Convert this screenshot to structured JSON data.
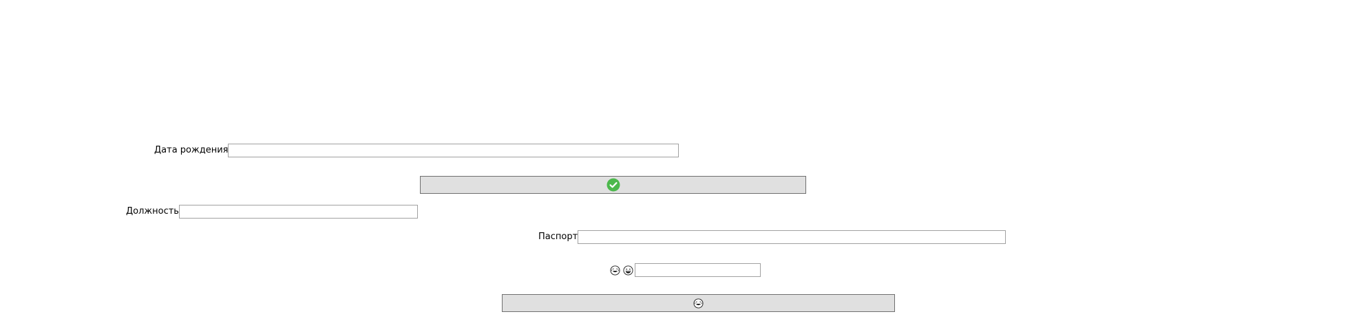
{
  "form": {
    "birth_date": {
      "label": "Дата рождения",
      "value": ""
    },
    "position": {
      "label": "Должность",
      "value": ""
    },
    "passport": {
      "label": "Паспорт",
      "value": ""
    },
    "emoji_field": {
      "value": ""
    }
  },
  "buttons": {
    "confirm": {
      "icon": "check-circle-icon",
      "color": "#4cb84c"
    },
    "emoji": {
      "icon": "laughing-face-icon"
    }
  },
  "icons": {
    "emoji_1": "laughing-face-icon",
    "emoji_2": "grinning-face-icon"
  }
}
